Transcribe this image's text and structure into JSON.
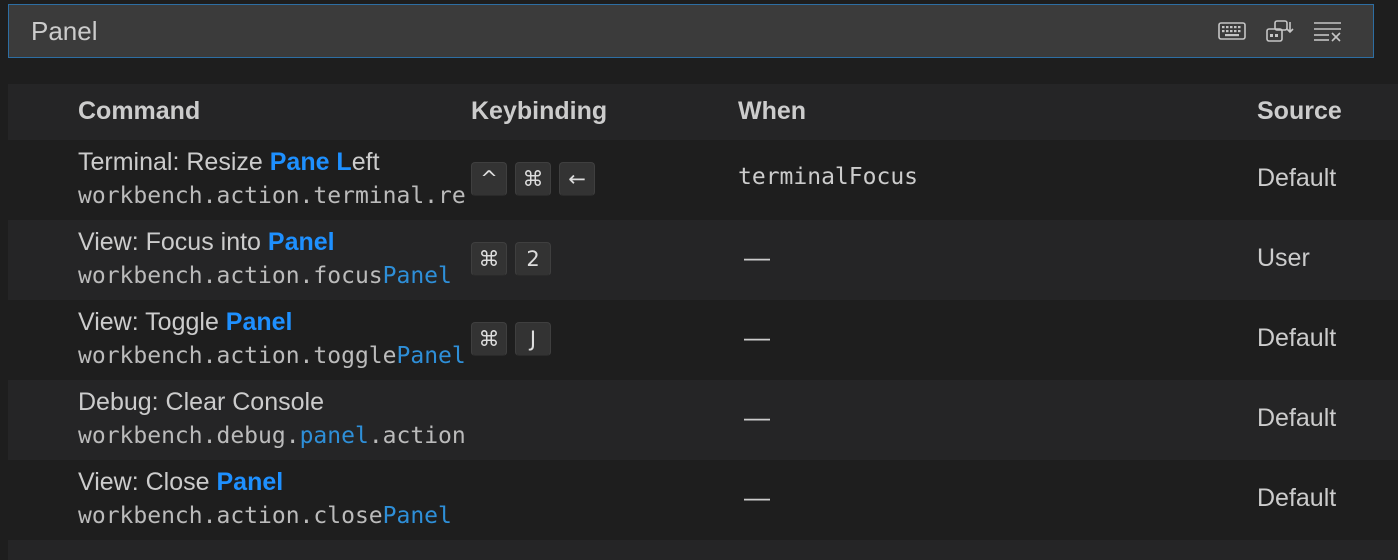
{
  "search": {
    "value": "Panel"
  },
  "actions": [
    {
      "icon": "keyboard-icon"
    },
    {
      "icon": "sort-by-precedence-icon"
    },
    {
      "icon": "clear-search-icon"
    }
  ],
  "columns": {
    "command": "Command",
    "keybinding": "Keybinding",
    "when": "When",
    "source": "Source"
  },
  "rows": [
    {
      "title_pre": "Terminal: Resize ",
      "title_hl": "Pane L",
      "title_post": "eft",
      "id_pre": "workbench.action.terminal.re",
      "id_hl": "",
      "id_post": "",
      "keys": [
        "^",
        "⌘",
        "←"
      ],
      "when": "terminalFocus",
      "source": "Default"
    },
    {
      "title_pre": "View: Focus into ",
      "title_hl": "Panel",
      "title_post": "",
      "id_pre": "workbench.action.focus",
      "id_hl": "Panel",
      "id_post": "",
      "keys": [
        "⌘",
        "2"
      ],
      "when": "—",
      "source": "User"
    },
    {
      "title_pre": "View: Toggle ",
      "title_hl": "Panel",
      "title_post": "",
      "id_pre": "workbench.action.toggle",
      "id_hl": "Panel",
      "id_post": "",
      "keys": [
        "⌘",
        "J"
      ],
      "when": "—",
      "source": "Default"
    },
    {
      "title_pre": "Debug: Clear Console",
      "title_hl": "",
      "title_post": "",
      "id_pre": "workbench.debug.",
      "id_hl": "panel",
      "id_post": ".action",
      "keys": [],
      "when": "—",
      "source": "Default"
    },
    {
      "title_pre": "View: Close ",
      "title_hl": "Panel",
      "title_post": "",
      "id_pre": "workbench.action.close",
      "id_hl": "Panel",
      "id_post": "",
      "keys": [],
      "when": "—",
      "source": "Default"
    }
  ]
}
